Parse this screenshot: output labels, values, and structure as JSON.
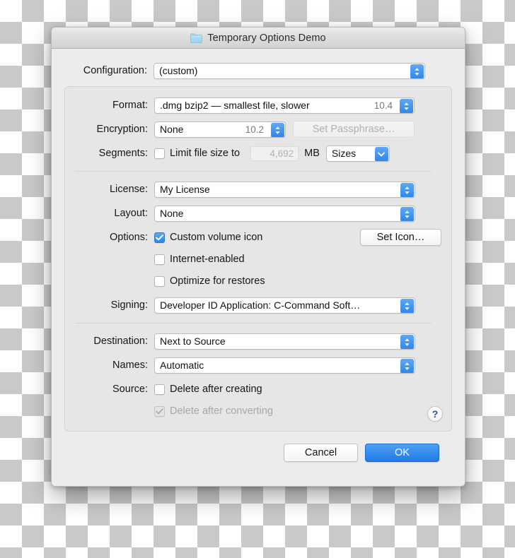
{
  "window": {
    "title": "Temporary Options Demo",
    "icon": "folder-icon"
  },
  "configuration": {
    "label": "Configuration:",
    "value": "(custom)"
  },
  "format": {
    "label": "Format:",
    "value": ".dmg bzip2 — smallest file, slower",
    "version": "10.4"
  },
  "encryption": {
    "label": "Encryption:",
    "value": "None",
    "version": "10.2",
    "passphrase_button": "Set Passphrase…"
  },
  "segments": {
    "label": "Segments:",
    "limit_checkbox_label": "Limit file size to",
    "limit_checked": false,
    "size_value": "4,692",
    "unit": "MB",
    "mode_value": "Sizes"
  },
  "license": {
    "label": "License:",
    "value": "My License"
  },
  "layout": {
    "label": "Layout:",
    "value": "None"
  },
  "options": {
    "label": "Options:",
    "set_icon_button": "Set Icon…",
    "items": [
      {
        "label": "Custom volume icon",
        "checked": true,
        "disabled": false
      },
      {
        "label": "Internet-enabled",
        "checked": false,
        "disabled": false
      },
      {
        "label": "Optimize for restores",
        "checked": false,
        "disabled": false
      }
    ]
  },
  "signing": {
    "label": "Signing:",
    "value": "Developer ID Application: C-Command Soft…"
  },
  "destination": {
    "label": "Destination:",
    "value": "Next to Source"
  },
  "names": {
    "label": "Names:",
    "value": "Automatic"
  },
  "source": {
    "label": "Source:",
    "items": [
      {
        "label": "Delete after creating",
        "checked": false,
        "disabled": false
      },
      {
        "label": "Delete after converting",
        "checked": true,
        "disabled": true
      }
    ]
  },
  "help": {
    "glyph": "?"
  },
  "footer": {
    "cancel_label": "Cancel",
    "ok_label": "OK"
  },
  "colors": {
    "accent": "#2f85e8",
    "window_bg": "#ececec",
    "group_bg": "#e6e6e6"
  }
}
